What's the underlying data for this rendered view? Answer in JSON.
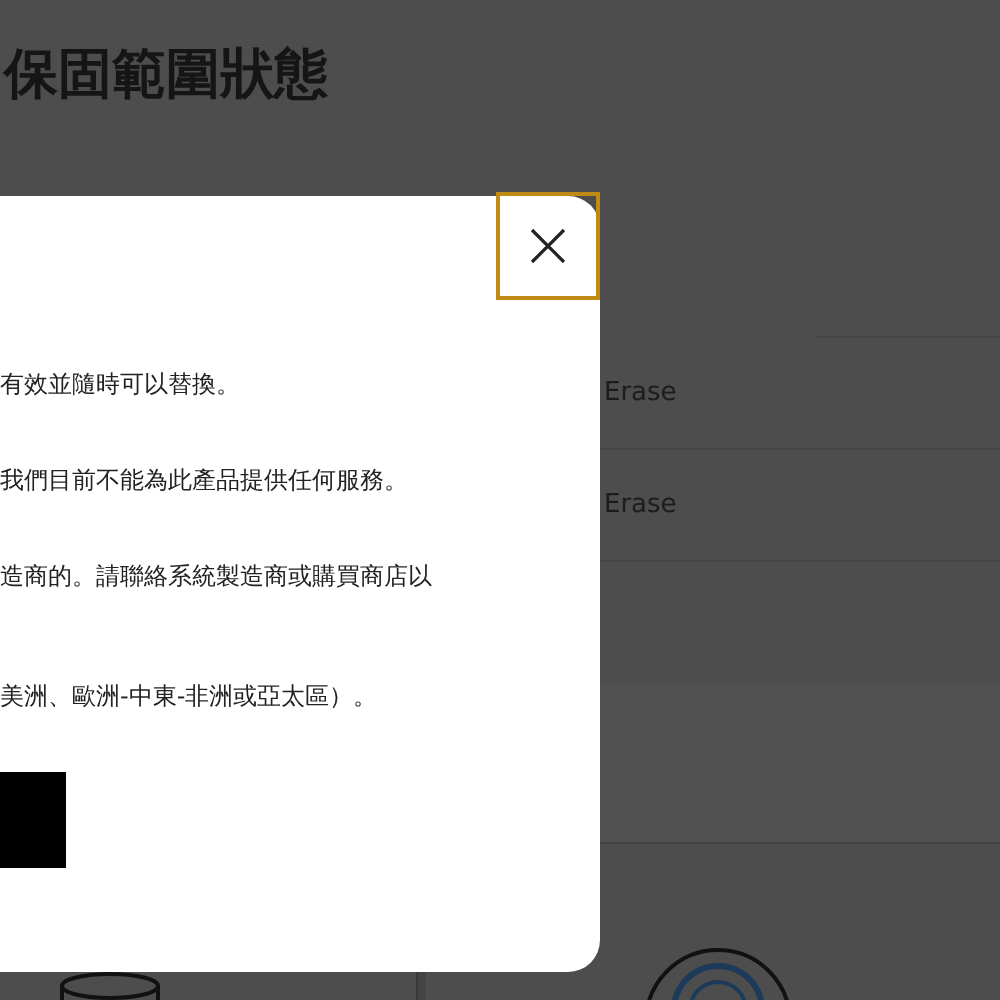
{
  "page": {
    "title": "保固範圍狀態",
    "rows": [
      {
        "value": "Erase"
      },
      {
        "value": "Erase"
      }
    ]
  },
  "dialog": {
    "paragraphs": [
      "有效並隨時可以替換。",
      "我們目前不能為此產品提供任何服務。",
      "造商的。請聯絡系統製造商或購買商店以",
      "美洲、歐洲-中東-非洲或亞太區）。"
    ]
  }
}
